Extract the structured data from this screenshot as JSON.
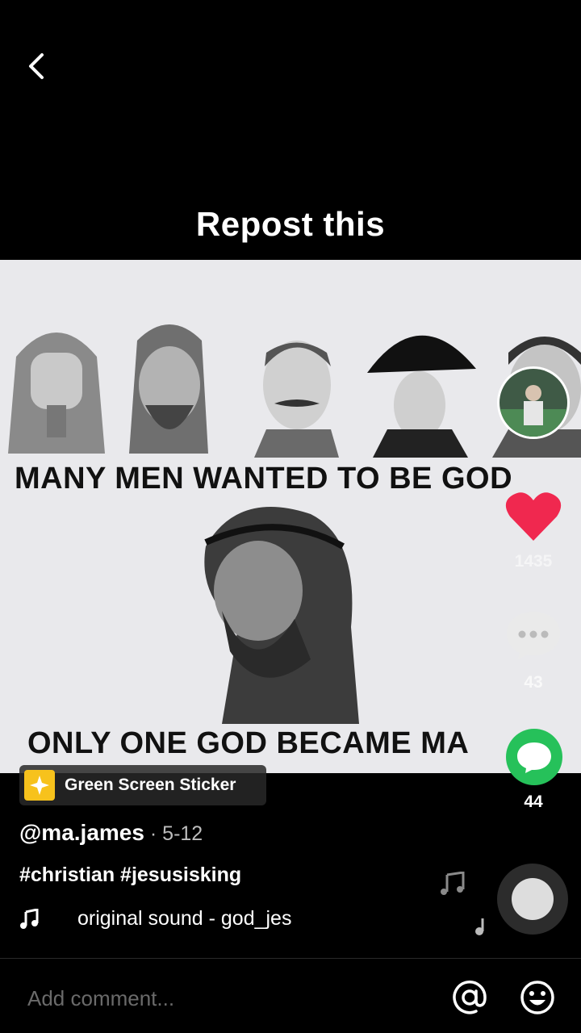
{
  "caption": "Repost this",
  "meme": {
    "line1": "MANY MEN WANTED TO BE GOD",
    "line2": "ONLY ONE GOD BECAME MA"
  },
  "sticker": {
    "label": "Green Screen Sticker"
  },
  "post": {
    "username": "@ma.james",
    "date": " · 5-12",
    "hashtags": "#christian #jesusisking",
    "sound": "original sound - god_jes"
  },
  "actions": {
    "likes": "1435",
    "comments": "43",
    "shares": "44"
  },
  "comment_bar": {
    "placeholder": "Add comment..."
  },
  "colors": {
    "like": "#f0284f",
    "share": "#26c15a",
    "sticker": "#f7c21c"
  },
  "icons": [
    "back-icon",
    "heart-icon",
    "comment-icon",
    "share-icon",
    "music-note-icon",
    "at-icon",
    "emoji-icon"
  ]
}
